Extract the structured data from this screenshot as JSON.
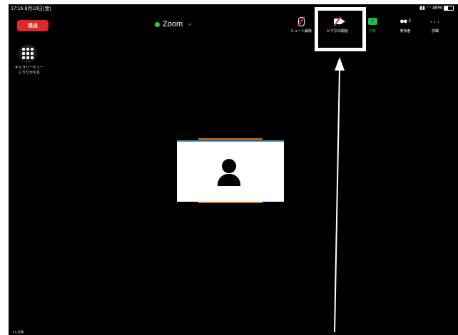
{
  "status_bar": {
    "time_date": "17:16  8月10日(金)",
    "battery": "46%"
  },
  "header": {
    "leave_label": "退出",
    "title": "Zoom",
    "toolbar": [
      {
        "label": "ミュート解除",
        "icon": "mic-muted-icon"
      },
      {
        "label": "ビデオの開始",
        "icon": "video-off-icon"
      },
      {
        "label": "共有",
        "icon": "share-icon"
      },
      {
        "label": "参加者",
        "icon": "participants-icon",
        "count": "2"
      },
      {
        "label": "詳細",
        "icon": "more-icon"
      }
    ]
  },
  "gallery": {
    "label": "ギャラリービュー にりりかえる"
  },
  "footer": {
    "text": "ｎに交換"
  },
  "colors": {
    "leave": "#e02828",
    "share": "#1db954",
    "tile_accent": "#e07a1c",
    "background": "#000000"
  }
}
